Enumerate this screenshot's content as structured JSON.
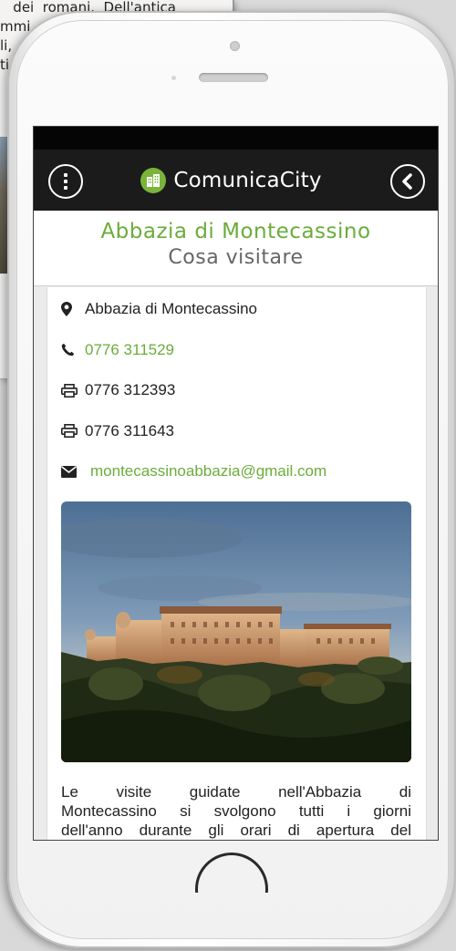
{
  "background_page": {
    "lines": [
      "   dei  romani.  Dell'antica",
      "mmi",
      "li,",
      "ti",
      "  i"
    ]
  },
  "app": {
    "name": "ComunicaCity",
    "brand_color": "#6aad3a",
    "menu_icon": "menu-icon",
    "back_icon": "back-chevron-icon"
  },
  "header": {
    "title": "Abbazia di Montecassino",
    "subtitle": "Cosa visitare"
  },
  "contact": {
    "address": "Abbazia di Montecassino",
    "phone": "0776 311529",
    "fax1": "0776 312393",
    "fax2": "0776 311643",
    "email": "montecassinoabbazia@gmail.com"
  },
  "photo": {
    "icon": "abbey-photo"
  },
  "description": {
    "line1": "Le visite guidate nell'Abbazia di",
    "line2": "Montecassino si svolgono tutti i giorni",
    "line3": "dell'anno durante gli orari di apertura del"
  }
}
